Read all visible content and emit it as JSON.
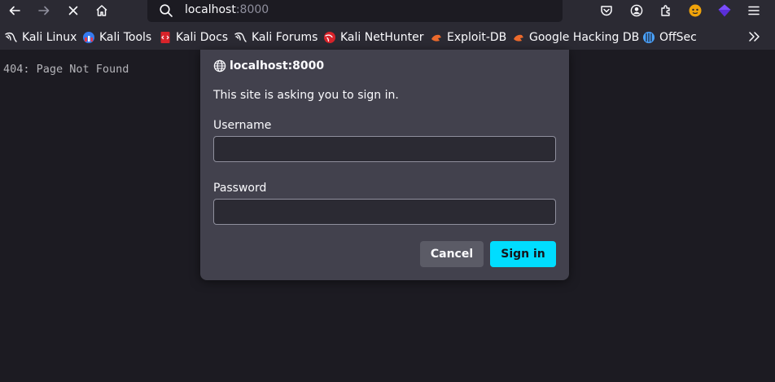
{
  "toolbar": {
    "url_host": "localhost",
    "url_port": ":8000"
  },
  "bookmarks": [
    {
      "label": "Kali Linux",
      "icon": "kali-dragon-icon"
    },
    {
      "label": "Kali Tools",
      "icon": "kali-tools-icon"
    },
    {
      "label": "Kali Docs",
      "icon": "kali-docs-icon"
    },
    {
      "label": "Kali Forums",
      "icon": "kali-dragon-icon"
    },
    {
      "label": "Kali NetHunter",
      "icon": "nethunter-icon"
    },
    {
      "label": "Exploit-DB",
      "icon": "exploit-db-icon"
    },
    {
      "label": "Google Hacking DB",
      "icon": "exploit-db-icon"
    },
    {
      "label": "OffSec",
      "icon": "offsec-icon"
    }
  ],
  "page": {
    "text": "404: Page Not Found"
  },
  "dialog": {
    "host": "localhost:8000",
    "message": "This site is asking you to sign in.",
    "username_label": "Username",
    "username_value": "",
    "password_label": "Password",
    "password_value": "",
    "cancel_label": "Cancel",
    "signin_label": "Sign in"
  },
  "colors": {
    "accent": "#00ddff",
    "toolbar": "#2b2a33",
    "dialog": "#42414d",
    "page_bg": "#1c1b22"
  }
}
